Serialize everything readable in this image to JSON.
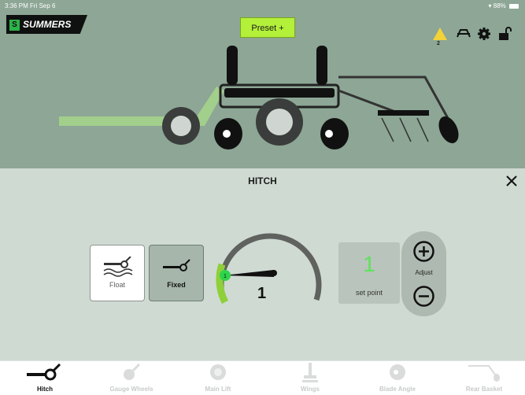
{
  "status": {
    "time": "3:36 PM  Fri Sep 6",
    "battery": "88%"
  },
  "header": {
    "logo_text": "SUMMERS",
    "preset_label": "Preset +",
    "warning_count": "2",
    "icons": [
      "warning-icon",
      "hitch-link-icon",
      "gear-icon",
      "unlock-icon"
    ]
  },
  "panel": {
    "title": "HITCH",
    "modes": [
      {
        "label": "Float",
        "selected": false
      },
      {
        "label": "Fixed",
        "selected": true
      }
    ],
    "gauge_marker": "1",
    "gauge_value": "1",
    "setpoint_value": "1",
    "setpoint_label": "set point",
    "adjust_label": "Adjust"
  },
  "tabs": [
    {
      "label": "Hitch",
      "active": true
    },
    {
      "label": "Gauge Wheels",
      "active": false
    },
    {
      "label": "Main Lift",
      "active": false
    },
    {
      "label": "Wings",
      "active": false
    },
    {
      "label": "Blade Angle",
      "active": false
    },
    {
      "label": "Rear Basket",
      "active": false
    }
  ],
  "colors": {
    "accent_green": "#5de35a",
    "preset_green": "#b3f03a",
    "header_bg": "#8da695",
    "panel_bg": "#cfdad2"
  }
}
